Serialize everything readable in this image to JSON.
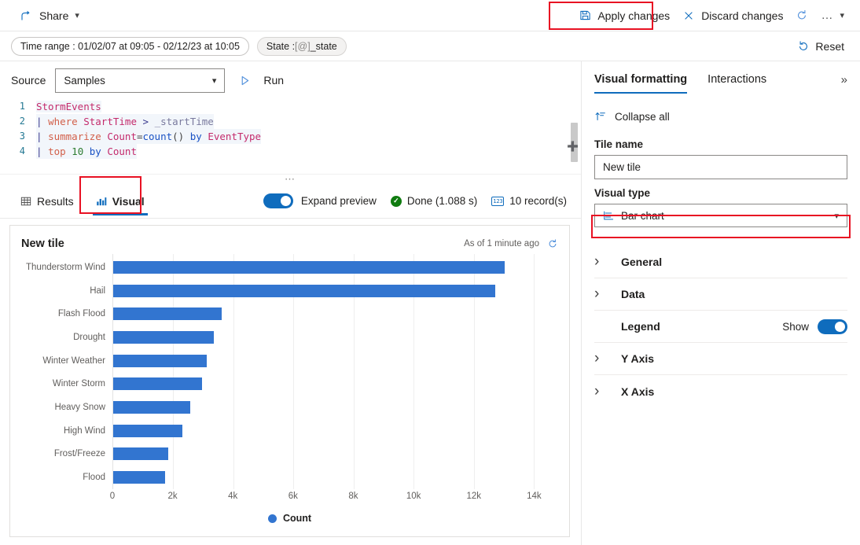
{
  "commandbar": {
    "share_label": "Share",
    "apply_label": "Apply changes",
    "discard_label": "Discard changes",
    "refresh_icon": "refresh-icon",
    "more_icon": "ellipsis-icon",
    "chevron_icon": "chevron-down-icon"
  },
  "parambar": {
    "time_range_label": "Time range : 01/02/07 at 09:05 - 02/12/23 at 10:05",
    "state_prefix": "State : ",
    "state_token": "[@]",
    "state_value": "_state",
    "reset_label": "Reset"
  },
  "query": {
    "source_label": "Source",
    "source_value": "Samples",
    "run_label": "Run",
    "lines": [
      {
        "n": "1",
        "text": "StormEvents"
      },
      {
        "n": "2",
        "text": "| where StartTime > _startTime"
      },
      {
        "n": "3",
        "text": "| summarize Count=count() by EventType"
      },
      {
        "n": "4",
        "text": "| top 10 by Count"
      }
    ]
  },
  "resultsbar": {
    "tab_results": "Results",
    "tab_visual": "Visual",
    "expand_preview_label": "Expand preview",
    "expand_preview_on": true,
    "status_text": "Done (1.088 s)",
    "records_text": "10 record(s)"
  },
  "tile": {
    "title": "New tile",
    "as_of": "As of 1 minute ago",
    "refresh_icon": "refresh-icon"
  },
  "chart_data": {
    "type": "bar",
    "orientation": "horizontal",
    "title": "New tile",
    "xlabel": "",
    "ylabel": "",
    "xlim": [
      0,
      14800
    ],
    "xticks": [
      0,
      2000,
      4000,
      6000,
      8000,
      10000,
      12000,
      14000
    ],
    "xticklabels": [
      "0",
      "2k",
      "4k",
      "6k",
      "8k",
      "10k",
      "12k",
      "14k"
    ],
    "grid": true,
    "legend": [
      "Count"
    ],
    "legend_position": "bottom",
    "series_color": "#3275d0",
    "categories": [
      "Thunderstorm Wind",
      "Hail",
      "Flash Flood",
      "Drought",
      "Winter Weather",
      "Winter Storm",
      "Heavy Snow",
      "High Wind",
      "Frost/Freeze",
      "Flood"
    ],
    "series": [
      {
        "name": "Count",
        "values": [
          13015,
          12711,
          3600,
          3350,
          3100,
          2950,
          2550,
          2300,
          1830,
          1720
        ]
      }
    ]
  },
  "format_panel": {
    "tab_visual_formatting": "Visual formatting",
    "tab_interactions": "Interactions",
    "expand_icon": "double-chevron-right-icon",
    "collapse_all_label": "Collapse all",
    "tile_name_label": "Tile name",
    "tile_name_value": "New tile",
    "visual_type_label": "Visual type",
    "visual_type_value": "Bar chart",
    "sections": [
      {
        "name": "General",
        "collapsible": true,
        "toggle": null,
        "toggle_label": null
      },
      {
        "name": "Data",
        "collapsible": true,
        "toggle": null,
        "toggle_label": null
      },
      {
        "name": "Legend",
        "collapsible": false,
        "toggle": true,
        "toggle_label": "Show"
      },
      {
        "name": "Y Axis",
        "collapsible": true,
        "toggle": null,
        "toggle_label": null
      },
      {
        "name": "X Axis",
        "collapsible": true,
        "toggle": null,
        "toggle_label": null
      }
    ]
  },
  "colors": {
    "accent": "#0f6cbd",
    "bar": "#3275d0",
    "success": "#107c10",
    "annotation": "#e81123"
  }
}
